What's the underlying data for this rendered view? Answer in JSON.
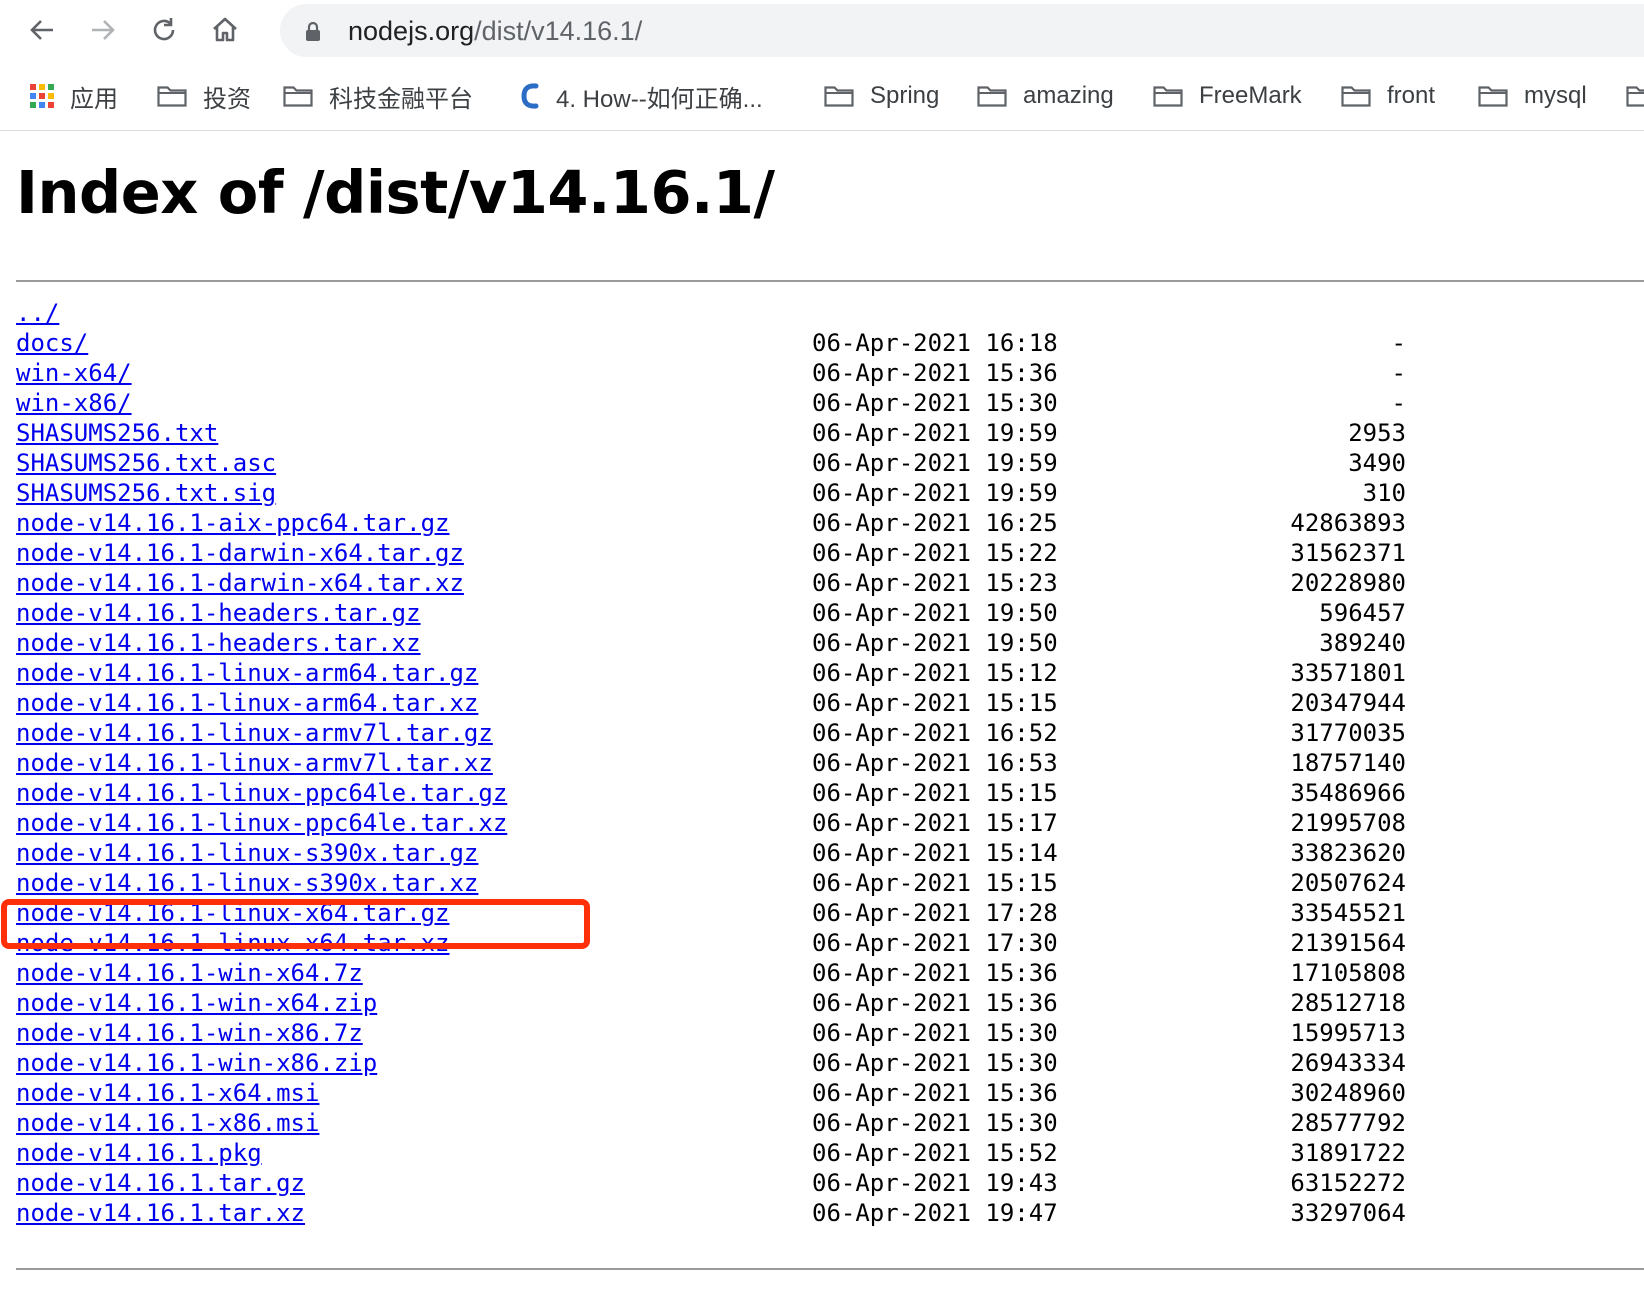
{
  "browser": {
    "url_host": "nodejs.org",
    "url_path": "/dist/v14.16.1/",
    "bookmarks": [
      {
        "label": "应用",
        "icon": "apps-grid-icon"
      },
      {
        "label": "投资",
        "icon": "folder-icon"
      },
      {
        "label": "科技金融平台",
        "icon": "folder-icon"
      },
      {
        "label": "4. How--如何正确...",
        "icon": "bookmark-favicon-icon"
      },
      {
        "label": "Spring",
        "icon": "folder-icon"
      },
      {
        "label": "amazing",
        "icon": "folder-icon"
      },
      {
        "label": "FreeMark",
        "icon": "folder-icon"
      },
      {
        "label": "front",
        "icon": "folder-icon"
      },
      {
        "label": "mysql",
        "icon": "folder-icon"
      }
    ]
  },
  "page": {
    "title": "Index of /dist/v14.16.1/",
    "highlighted_entry": "node-v14.16.1-linux-x64.tar.gz",
    "highlight_color": "#ff2f0a",
    "link_color": "#0000ee",
    "entries": [
      {
        "name": "../",
        "date": "",
        "size": ""
      },
      {
        "name": "docs/",
        "date": "06-Apr-2021 16:18",
        "size": "-"
      },
      {
        "name": "win-x64/",
        "date": "06-Apr-2021 15:36",
        "size": "-"
      },
      {
        "name": "win-x86/",
        "date": "06-Apr-2021 15:30",
        "size": "-"
      },
      {
        "name": "SHASUMS256.txt",
        "date": "06-Apr-2021 19:59",
        "size": "2953"
      },
      {
        "name": "SHASUMS256.txt.asc",
        "date": "06-Apr-2021 19:59",
        "size": "3490"
      },
      {
        "name": "SHASUMS256.txt.sig",
        "date": "06-Apr-2021 19:59",
        "size": "310"
      },
      {
        "name": "node-v14.16.1-aix-ppc64.tar.gz",
        "date": "06-Apr-2021 16:25",
        "size": "42863893"
      },
      {
        "name": "node-v14.16.1-darwin-x64.tar.gz",
        "date": "06-Apr-2021 15:22",
        "size": "31562371"
      },
      {
        "name": "node-v14.16.1-darwin-x64.tar.xz",
        "date": "06-Apr-2021 15:23",
        "size": "20228980"
      },
      {
        "name": "node-v14.16.1-headers.tar.gz",
        "date": "06-Apr-2021 19:50",
        "size": "596457"
      },
      {
        "name": "node-v14.16.1-headers.tar.xz",
        "date": "06-Apr-2021 19:50",
        "size": "389240"
      },
      {
        "name": "node-v14.16.1-linux-arm64.tar.gz",
        "date": "06-Apr-2021 15:12",
        "size": "33571801"
      },
      {
        "name": "node-v14.16.1-linux-arm64.tar.xz",
        "date": "06-Apr-2021 15:15",
        "size": "20347944"
      },
      {
        "name": "node-v14.16.1-linux-armv7l.tar.gz",
        "date": "06-Apr-2021 16:52",
        "size": "31770035"
      },
      {
        "name": "node-v14.16.1-linux-armv7l.tar.xz",
        "date": "06-Apr-2021 16:53",
        "size": "18757140"
      },
      {
        "name": "node-v14.16.1-linux-ppc64le.tar.gz",
        "date": "06-Apr-2021 15:15",
        "size": "35486966"
      },
      {
        "name": "node-v14.16.1-linux-ppc64le.tar.xz",
        "date": "06-Apr-2021 15:17",
        "size": "21995708"
      },
      {
        "name": "node-v14.16.1-linux-s390x.tar.gz",
        "date": "06-Apr-2021 15:14",
        "size": "33823620"
      },
      {
        "name": "node-v14.16.1-linux-s390x.tar.xz",
        "date": "06-Apr-2021 15:15",
        "size": "20507624"
      },
      {
        "name": "node-v14.16.1-linux-x64.tar.gz",
        "date": "06-Apr-2021 17:28",
        "size": "33545521"
      },
      {
        "name": "node-v14.16.1-linux-x64.tar.xz",
        "date": "06-Apr-2021 17:30",
        "size": "21391564"
      },
      {
        "name": "node-v14.16.1-win-x64.7z",
        "date": "06-Apr-2021 15:36",
        "size": "17105808"
      },
      {
        "name": "node-v14.16.1-win-x64.zip",
        "date": "06-Apr-2021 15:36",
        "size": "28512718"
      },
      {
        "name": "node-v14.16.1-win-x86.7z",
        "date": "06-Apr-2021 15:30",
        "size": "15995713"
      },
      {
        "name": "node-v14.16.1-win-x86.zip",
        "date": "06-Apr-2021 15:30",
        "size": "26943334"
      },
      {
        "name": "node-v14.16.1-x64.msi",
        "date": "06-Apr-2021 15:36",
        "size": "30248960"
      },
      {
        "name": "node-v14.16.1-x86.msi",
        "date": "06-Apr-2021 15:30",
        "size": "28577792"
      },
      {
        "name": "node-v14.16.1.pkg",
        "date": "06-Apr-2021 15:52",
        "size": "31891722"
      },
      {
        "name": "node-v14.16.1.tar.gz",
        "date": "06-Apr-2021 19:43",
        "size": "63152272"
      },
      {
        "name": "node-v14.16.1.tar.xz",
        "date": "06-Apr-2021 19:47",
        "size": "33297064"
      }
    ]
  }
}
